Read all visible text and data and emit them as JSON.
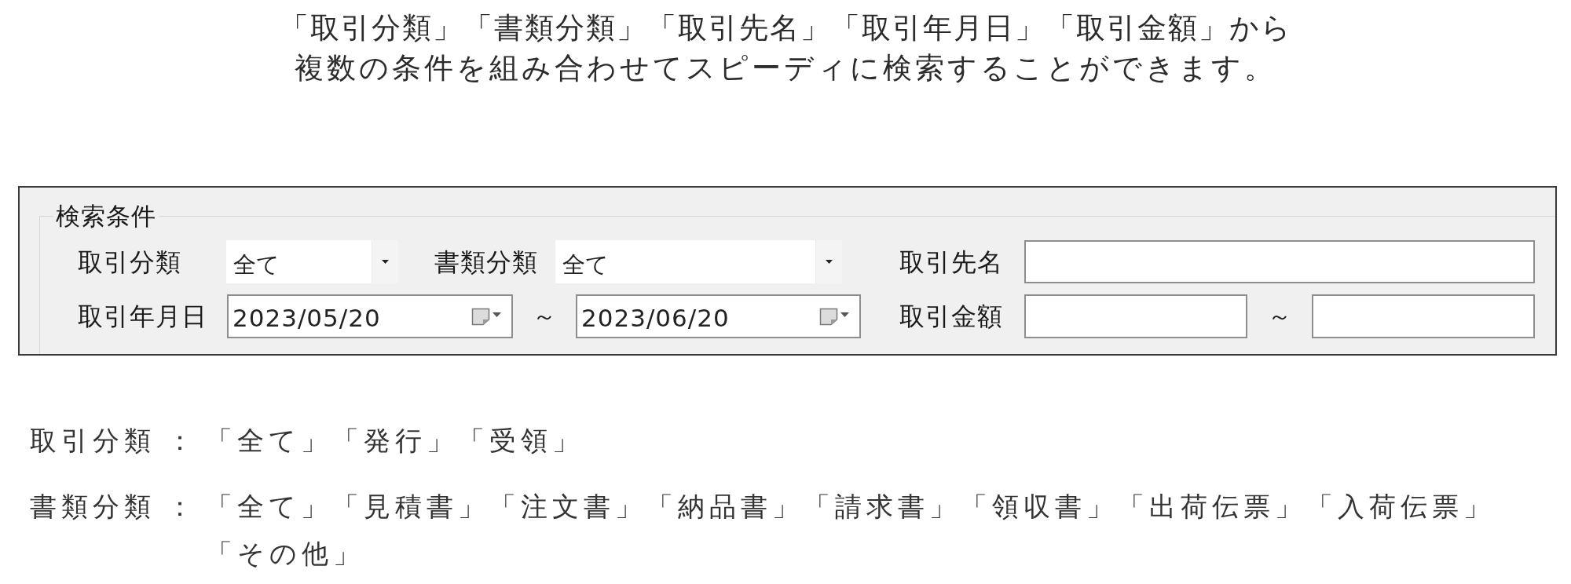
{
  "intro_lines": [
    "「取引分類」「書類分類」「取引先名」「取引年月日」「取引金額」から",
    "複数の条件を組み合わせてスピーディに検索することができます。"
  ],
  "search_conditions": {
    "title": "検索条件",
    "rows": [
      {
        "fields": [
          {
            "kind": "combo",
            "label": "取引分類",
            "value": "全て"
          },
          {
            "kind": "combo",
            "label": "書類分類",
            "value": "全て"
          },
          {
            "kind": "text",
            "label": "取引先名"
          }
        ]
      },
      {
        "fields": [
          {
            "kind": "date_range",
            "label": "取引年月日",
            "from": "2023/05/20",
            "separator": "～",
            "to": "2023/06/20"
          },
          {
            "kind": "amount_range",
            "label": "取引金額",
            "separator": "～"
          }
        ]
      }
    ]
  },
  "categories": [
    {
      "label": "取引分類",
      "colon": "：",
      "options": [
        "「全て」",
        "「発行」",
        "「受領」"
      ]
    },
    {
      "label": "書類分類",
      "colon": "：",
      "options": [
        "「全て」",
        "「見積書」",
        "「注文書」",
        "「納品書」",
        "「請求書」",
        "「領収書」",
        "「出荷伝票」",
        "「入荷伝票」",
        "「その他」"
      ]
    }
  ]
}
